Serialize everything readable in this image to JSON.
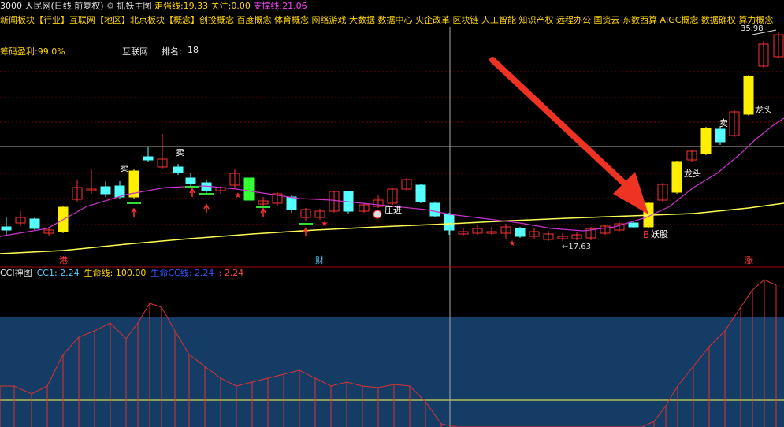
{
  "header": {
    "symbol": "3000 人民网(日线 前复权)",
    "main_indicator": "抓妖主图",
    "lines": [
      {
        "label": "走强线:",
        "value": "19.33",
        "color": "#ffd400"
      },
      {
        "label": "关注:",
        "value": "0.00",
        "color": "#ffd400"
      },
      {
        "label": "支撑线:",
        "value": "21.06",
        "color": "#ff44ff"
      }
    ]
  },
  "concepts": "新闻板块【行业】互联网【地区】北京板块【概念】创投概念 百度概念 体育概念 网络游戏 大数据 数据中心 央企改革 区块链 人工智能 知识产权 远程办公 国资云 东数西算 AIGC概念 数据确权 算力概念",
  "info": {
    "profit": "筹码盈利:99.0%",
    "industry": "互联网",
    "rank_label": "排名:",
    "rank_value": "18"
  },
  "price_labels": {
    "top_price": "35.98",
    "low_price": "17.63"
  },
  "annotations": {
    "sell1": "卖",
    "sell2": "卖",
    "zhuangjin": "庄进",
    "longtou1": "龙头",
    "longtou2": "龙头",
    "yaogu": "妖股",
    "b": "B",
    "bottom_gang": "港",
    "bottom_cai": "财",
    "bottom_zhang": "涨"
  },
  "sub_legend": {
    "name": "CCI神图",
    "cc1": "CC1: 2.24",
    "life": "生命线: 100.00",
    "sheng": "生命CC线: 2.24",
    "extra": ": 2.24"
  },
  "colors": {
    "up": "#ff3333",
    "down": "#55ffff",
    "ma_yellow": "#ffff55",
    "ma_magenta": "#cc33cc",
    "signal_yellow": "#ffee00",
    "arrow": "#ee3322",
    "sub_fill": "#143c64"
  }
}
